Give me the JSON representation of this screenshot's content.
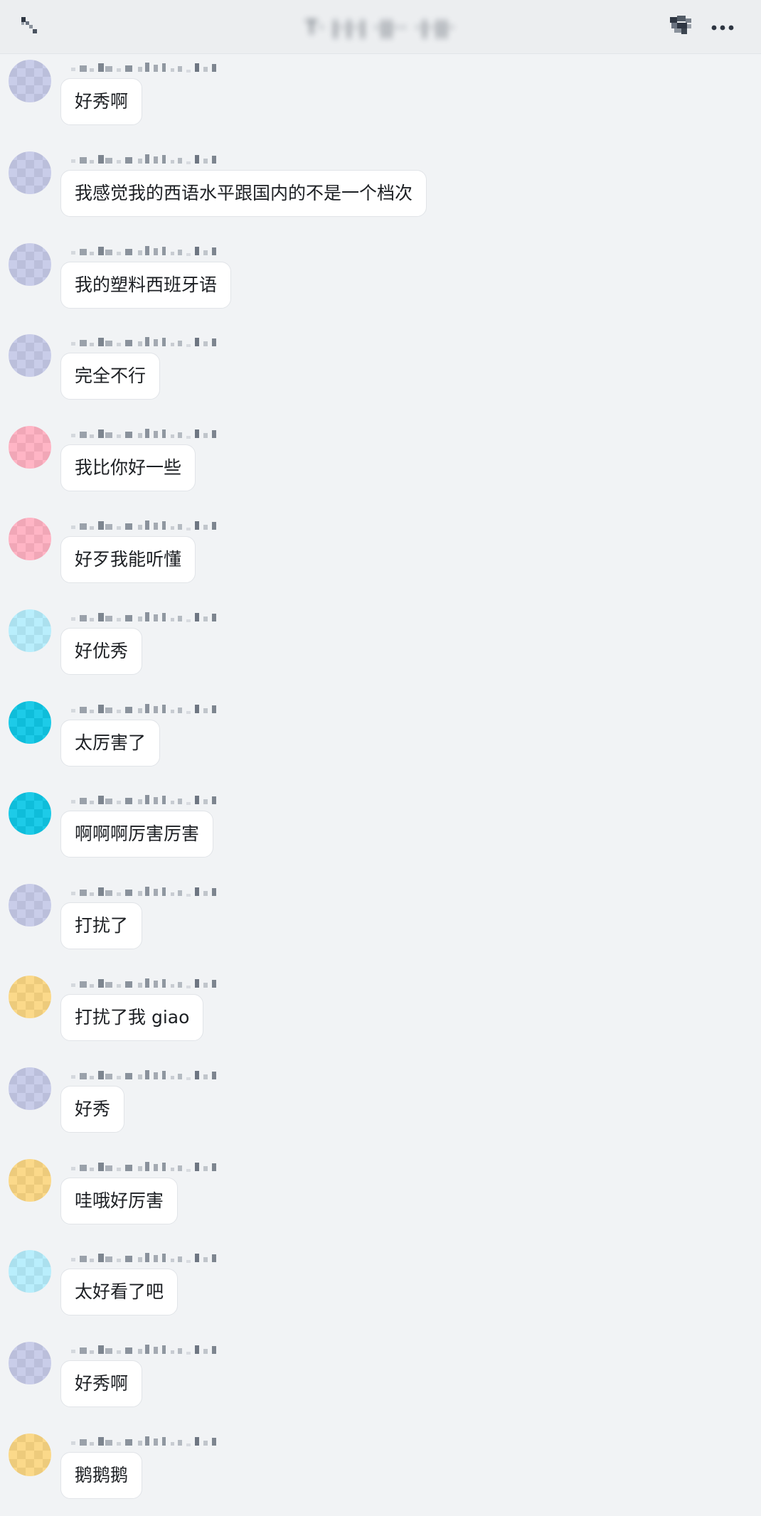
{
  "header": {
    "title": "T· ǀ·ǀ·ǀ ·ǀǀ·· ·ǀ·ǀǀ·",
    "back_icon": "back-arrow-icon",
    "people_icon": "group-members-icon",
    "more_icon": "more-dots-icon"
  },
  "avatar_colors": {
    "lavender": "#c9cde9",
    "pink": "#ffb5c5",
    "aqua": "#b9eefc",
    "cyan": "#1dcbe8",
    "gold": "#fbd98a"
  },
  "messages": [
    {
      "avatar": "lavender",
      "text": "好秀啊"
    },
    {
      "avatar": "lavender",
      "text": "我感觉我的西语水平跟国内的不是一个档次"
    },
    {
      "avatar": "lavender",
      "text": "我的塑料西班牙语"
    },
    {
      "avatar": "lavender",
      "text": "完全不行"
    },
    {
      "avatar": "pink",
      "text": "我比你好一些"
    },
    {
      "avatar": "pink",
      "text": "好歹我能听懂"
    },
    {
      "avatar": "aqua",
      "text": "好优秀"
    },
    {
      "avatar": "cyan",
      "text": "太厉害了"
    },
    {
      "avatar": "cyan",
      "text": "啊啊啊厉害厉害"
    },
    {
      "avatar": "lavender",
      "text": "打扰了"
    },
    {
      "avatar": "gold",
      "text": "打扰了我 giao"
    },
    {
      "avatar": "lavender",
      "text": "好秀"
    },
    {
      "avatar": "gold",
      "text": "哇哦好厉害"
    },
    {
      "avatar": "aqua",
      "text": "太好看了吧"
    },
    {
      "avatar": "lavender",
      "text": "好秀啊"
    },
    {
      "avatar": "gold",
      "text": "鹅鹅鹅"
    }
  ]
}
